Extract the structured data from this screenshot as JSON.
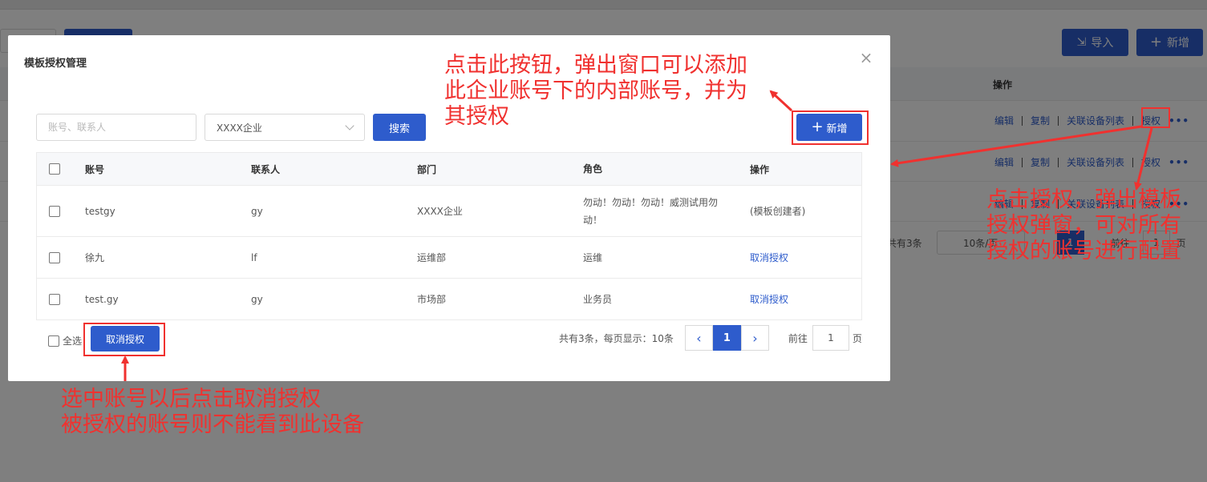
{
  "background": {
    "import_label": "导入",
    "add_label": "新增",
    "column_header": "操作",
    "row_actions": [
      "编辑",
      "复制",
      "关联设备列表",
      "授权"
    ],
    "more_dots": "•••",
    "pager": {
      "total": "共有3条",
      "page_size": "10条/页",
      "goto_label": "前往",
      "goto_value": "1",
      "unit": "页"
    }
  },
  "modal": {
    "title": "模板授权管理",
    "close_glyph": "×",
    "search_placeholder": "账号、联系人",
    "company_value": "XXXX企业",
    "search_label": "搜索",
    "add_label": "新增",
    "columns": [
      "账号",
      "联系人",
      "部门",
      "角色",
      "操作"
    ],
    "rows": [
      {
        "account": "testgy",
        "contact": "gy",
        "dept": "XXXX企业",
        "role": "勿动！勿动！勿动！威测试用勿动！",
        "op": "(模板创建者)"
      },
      {
        "account": "徐九",
        "contact": "lf",
        "dept": "运维部",
        "role": "运维",
        "op": "取消授权"
      },
      {
        "account": "test.gy",
        "contact": "gy",
        "dept": "市场部",
        "role": "业务员",
        "op": "取消授权"
      }
    ],
    "select_all": "全选",
    "cancel_auth_label": "取消授权",
    "pager": {
      "summary": "共有3条，每页显示：10条",
      "prev": "‹",
      "current": "1",
      "next": "›",
      "goto_label": "前往",
      "goto_value": "1",
      "unit": "页"
    }
  },
  "annotations": {
    "note1": [
      "点击此按钮，弹出窗口可以添加",
      "此企业账号下的内部账号，并为",
      "其授权"
    ],
    "note2": [
      "点击授权，弹出模板",
      "授权弹窗，可对所有",
      "授权的账号进行配置"
    ],
    "note3": [
      "选中账号以后点击取消授权",
      "被授权的账号则不能看到此设备"
    ]
  },
  "colors": {
    "primary": "#2e5ccc",
    "annotation_red": "#f0312f"
  }
}
